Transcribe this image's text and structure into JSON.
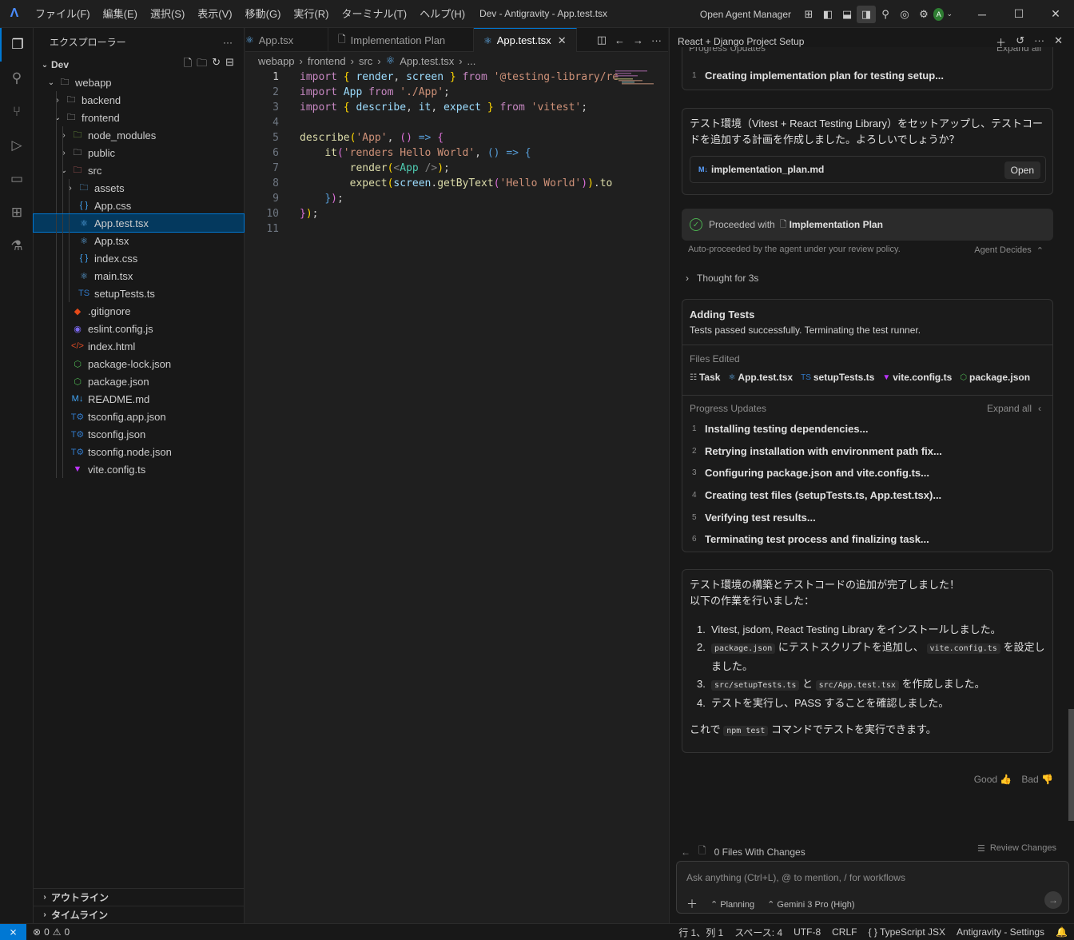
{
  "titlebar": {
    "menus": [
      "ファイル(F)",
      "編集(E)",
      "選択(S)",
      "表示(V)",
      "移動(G)",
      "実行(R)",
      "ターミナル(T)",
      "ヘルプ(H)"
    ],
    "window_title": "Dev - Antigravity - App.test.tsx",
    "open_agent_manager": "Open Agent Manager",
    "avatar_letter": "A"
  },
  "sidebar": {
    "title": "エクスプローラー",
    "root": "Dev",
    "tree": [
      {
        "label": "webapp",
        "depth": 1,
        "type": "folder-open",
        "icon": "folder-icon"
      },
      {
        "label": "backend",
        "depth": 2,
        "type": "folder",
        "icon": "folder-icon"
      },
      {
        "label": "frontend",
        "depth": 2,
        "type": "folder-open",
        "icon": "folder-icon"
      },
      {
        "label": "node_modules",
        "depth": 3,
        "type": "folder",
        "icon": "node-folder-icon"
      },
      {
        "label": "public",
        "depth": 3,
        "type": "folder",
        "icon": "public-folder-icon"
      },
      {
        "label": "src",
        "depth": 3,
        "type": "folder-open",
        "icon": "src-folder-icon"
      },
      {
        "label": "assets",
        "depth": 4,
        "type": "folder",
        "icon": "assets-folder-icon"
      },
      {
        "label": "App.css",
        "depth": 4,
        "type": "file",
        "icon": "css-file-icon"
      },
      {
        "label": "App.test.tsx",
        "depth": 4,
        "type": "file",
        "icon": "react-file-icon",
        "selected": true
      },
      {
        "label": "App.tsx",
        "depth": 4,
        "type": "file",
        "icon": "react-file-icon"
      },
      {
        "label": "index.css",
        "depth": 4,
        "type": "file",
        "icon": "css-file-icon"
      },
      {
        "label": "main.tsx",
        "depth": 4,
        "type": "file",
        "icon": "react-file-icon"
      },
      {
        "label": "setupTests.ts",
        "depth": 4,
        "type": "file",
        "icon": "ts-file-icon"
      },
      {
        "label": ".gitignore",
        "depth": 3,
        "type": "file",
        "icon": "git-file-icon"
      },
      {
        "label": "eslint.config.js",
        "depth": 3,
        "type": "file",
        "icon": "eslint-file-icon"
      },
      {
        "label": "index.html",
        "depth": 3,
        "type": "file",
        "icon": "html-file-icon"
      },
      {
        "label": "package-lock.json",
        "depth": 3,
        "type": "file",
        "icon": "npm-file-icon"
      },
      {
        "label": "package.json",
        "depth": 3,
        "type": "file",
        "icon": "npm-file-icon"
      },
      {
        "label": "README.md",
        "depth": 3,
        "type": "file",
        "icon": "markdown-file-icon"
      },
      {
        "label": "tsconfig.app.json",
        "depth": 3,
        "type": "file",
        "icon": "tsconfig-file-icon"
      },
      {
        "label": "tsconfig.json",
        "depth": 3,
        "type": "file",
        "icon": "tsconfig-file-icon"
      },
      {
        "label": "tsconfig.node.json",
        "depth": 3,
        "type": "file",
        "icon": "tsconfig-file-icon"
      },
      {
        "label": "vite.config.ts",
        "depth": 3,
        "type": "file",
        "icon": "vite-file-icon"
      }
    ],
    "outline": "アウトライン",
    "timeline": "タイムライン"
  },
  "editor": {
    "tabs": [
      {
        "label": "App.tsx",
        "icon": "react-file-icon",
        "active": false
      },
      {
        "label": "Implementation Plan",
        "icon": "document-icon",
        "active": false
      },
      {
        "label": "App.test.tsx",
        "icon": "react-file-icon",
        "active": true
      }
    ],
    "breadcrumb": [
      "webapp",
      "frontend",
      "src",
      "App.test.tsx",
      "..."
    ],
    "current_line": 1,
    "line_count": 11
  },
  "agent": {
    "title": "React + Django Project Setup",
    "top_partial": {
      "progress_label": "Progress Updates",
      "expand_label": "Expand all",
      "item_num": "1",
      "item": "Creating implementation plan for testing setup..."
    },
    "plan_card": {
      "text": "テスト環境（Vitest + React Testing Library）をセットアップし、テストコードを追加する計画を作成しました。よろしいでしょうか？",
      "file": "implementation_plan.md",
      "open_label": "Open"
    },
    "proceeded": {
      "prefix": "Proceeded with",
      "target": "Implementation Plan"
    },
    "auto_text": "Auto-proceeded by the agent under your review policy.",
    "agent_decides": "Agent Decides",
    "thought": "Thought for 3s",
    "task_card": {
      "title": "Adding Tests",
      "subtitle": "Tests passed successfully. Terminating the test runner.",
      "files_edited_label": "Files Edited",
      "files": [
        {
          "label": "Task",
          "icon": "task-icon"
        },
        {
          "label": "App.test.tsx",
          "icon": "react-file-icon"
        },
        {
          "label": "setupTests.ts",
          "icon": "ts-file-icon"
        },
        {
          "label": "vite.config.ts",
          "icon": "vite-file-icon"
        },
        {
          "label": "package.json",
          "icon": "npm-file-icon"
        }
      ],
      "progress_label": "Progress Updates",
      "expand_label": "Expand all",
      "updates": [
        "Installing testing dependencies...",
        "Retrying installation with environment path fix...",
        "Configuring package.json and vite.config.ts...",
        "Creating test files (setupTests.ts, App.test.tsx)...",
        "Verifying test results...",
        "Terminating test process and finalizing task..."
      ]
    },
    "summary": {
      "line1": "テスト環境の構築とテストコードの追加が完了しました！",
      "line2": "以下の作業を行いました：",
      "item1": "Vitest, jsdom, React Testing Library をインストールしました。",
      "item2_code1": "package.json",
      "item2_mid": "にテストスクリプトを追加し、",
      "item2_code2": "vite.config.ts",
      "item2_end": "を設定しました。",
      "item3_code1": "src/setupTests.ts",
      "item3_mid": "と",
      "item3_code2": "src/App.test.tsx",
      "item3_end": "を作成しました。",
      "item4": "テストを実行し、PASS することを確認しました。",
      "final_pre": "これで",
      "final_code": "npm test",
      "final_post": "コマンドでテストを実行できます。"
    },
    "good": "Good",
    "bad": "Bad",
    "files_changes": "0 Files With Changes",
    "review_changes": "Review Changes",
    "input_placeholder": "Ask anything (Ctrl+L), @ to mention, / for workflows",
    "mode": "Planning",
    "model": "Gemini 3 Pro (High)"
  },
  "status": {
    "errors": "0",
    "warnings": "0",
    "position": "行 1、列 1",
    "spaces": "スペース: 4",
    "encoding": "UTF-8",
    "eol": "CRLF",
    "language": "TypeScript JSX",
    "settings": "Antigravity - Settings"
  }
}
